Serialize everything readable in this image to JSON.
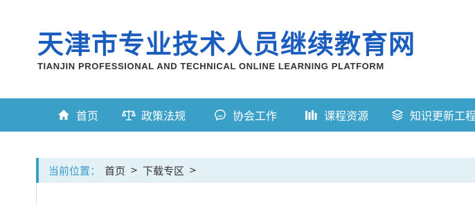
{
  "header": {
    "title": "天津市专业技术人员继续教育网",
    "subtitle": "TIANJIN PROFESSIONAL AND TECHNICAL ONLINE LEARNING PLATFORM"
  },
  "nav": {
    "items": [
      {
        "label": "首页",
        "icon": "home-icon"
      },
      {
        "label": "政策法规",
        "icon": "scales-icon"
      },
      {
        "label": "协会工作",
        "icon": "chat-icon"
      },
      {
        "label": "课程资源",
        "icon": "books-icon"
      },
      {
        "label": "知识更新工程",
        "icon": "layers-icon"
      }
    ]
  },
  "breadcrumb": {
    "label": "当前位置：",
    "items": [
      "首页",
      "下载专区"
    ],
    "separator": ">"
  },
  "colors": {
    "brand_blue": "#1a5dbf",
    "nav_background": "#3aa0c8",
    "breadcrumb_background": "#e3f1f6",
    "breadcrumb_label": "#3a9ccb"
  }
}
